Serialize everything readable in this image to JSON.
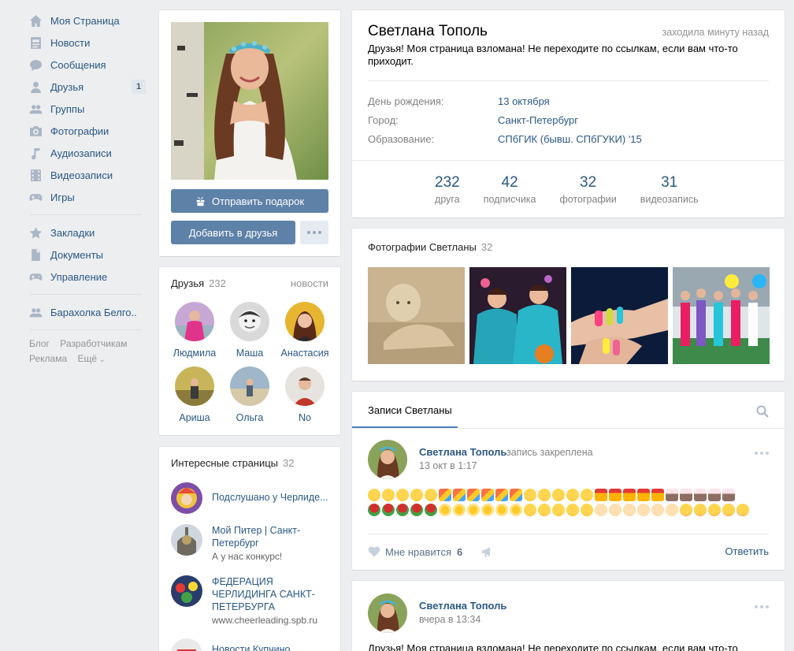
{
  "nav": {
    "items": [
      {
        "label": "Моя Страница",
        "icon": "home-icon"
      },
      {
        "label": "Новости",
        "icon": "news-icon"
      },
      {
        "label": "Сообщения",
        "icon": "messages-icon"
      },
      {
        "label": "Друзья",
        "icon": "friends-icon",
        "badge": "1"
      },
      {
        "label": "Группы",
        "icon": "groups-icon"
      },
      {
        "label": "Фотографии",
        "icon": "camera-icon"
      },
      {
        "label": "Аудиозаписи",
        "icon": "music-icon"
      },
      {
        "label": "Видеозаписи",
        "icon": "video-icon"
      },
      {
        "label": "Игры",
        "icon": "gamepad-icon"
      },
      {
        "label": "Закладки",
        "icon": "star-icon"
      },
      {
        "label": "Документы",
        "icon": "document-icon"
      },
      {
        "label": "Управление",
        "icon": "gamepad-icon"
      },
      {
        "label": "Барахолка Белго..",
        "icon": "groups-icon"
      }
    ],
    "footer": [
      "Блог",
      "Разработчикам",
      "Реклама",
      "Ещё"
    ]
  },
  "profile_actions": {
    "gift_button": "Отправить подарок",
    "add_friend_button": "Добавить в друзья"
  },
  "friends": {
    "title": "Друзья",
    "count": "232",
    "link": "новости",
    "list": [
      "Людмила",
      "Маша",
      "Анастасия",
      "Ариша",
      "Ольга",
      "No"
    ]
  },
  "pages": {
    "title": "Интересные страницы",
    "count": "32",
    "list": [
      {
        "name": "Подслушано у Черлиде...",
        "sub": ""
      },
      {
        "name": "Мой Питер | Санкт-Петербург",
        "sub": "А у нас конкурс!"
      },
      {
        "name": "ФЕДЕРАЦИЯ ЧЕРЛИДИНГА САНКТ-ПЕТЕРБУРГА",
        "sub": "www.cheerleading.spb.ru"
      },
      {
        "name": "Новости Купчино",
        "sub": ""
      }
    ]
  },
  "profile": {
    "name": "Светлана Тополь",
    "online": "заходила минуту назад",
    "status": "Друзья! Моя страница взломана! Не переходите по ссылкам, если вам что-то приходит.",
    "info": [
      {
        "key": "День рождения:",
        "value": "13 октября"
      },
      {
        "key": "Город:",
        "value": "Санкт-Петербург"
      },
      {
        "key": "Образование:",
        "value": "СПбГИК (бывш. СПбГУКИ) '15"
      }
    ],
    "counters": [
      {
        "num": "232",
        "label": "друга"
      },
      {
        "num": "42",
        "label": "подписчика"
      },
      {
        "num": "32",
        "label": "фотографии"
      },
      {
        "num": "31",
        "label": "видеозапись"
      }
    ]
  },
  "photos": {
    "title": "Фотографии Светланы",
    "count": "32"
  },
  "wall": {
    "tab": "Записи Светланы",
    "posts": [
      {
        "author": "Светлана Тополь",
        "pinned": "запись закреплена",
        "date": "13 окт в 1:17",
        "like_label": "Мне нравится",
        "like_count": "6",
        "reply": "Ответить"
      },
      {
        "author": "Светлана Тополь",
        "date": "вчера в 13:34",
        "text": "Друзья! Моя страница взломана! Не переходите по ссылкам, если вам что-то"
      }
    ]
  },
  "colors": {
    "background": "#edeef0",
    "link": "#2a5885",
    "button": "#5e81a8",
    "muted": "#939393"
  }
}
